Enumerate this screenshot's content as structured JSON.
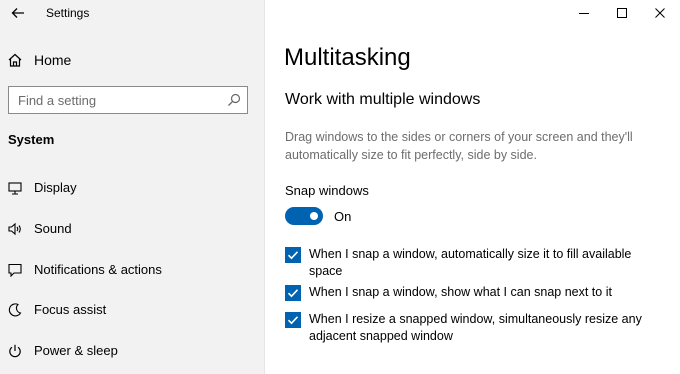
{
  "window": {
    "title": "Settings"
  },
  "sidebar": {
    "home_label": "Home",
    "search_placeholder": "Find a setting",
    "section_label": "System",
    "items": [
      {
        "label": "Display",
        "icon": "display-icon"
      },
      {
        "label": "Sound",
        "icon": "sound-icon"
      },
      {
        "label": "Notifications & actions",
        "icon": "notifications-icon"
      },
      {
        "label": "Focus assist",
        "icon": "focus-assist-icon"
      },
      {
        "label": "Power & sleep",
        "icon": "power-icon"
      }
    ]
  },
  "main": {
    "title": "Multitasking",
    "section_heading": "Work with multiple windows",
    "description": "Drag windows to the sides or corners of your screen and they'll automatically size to fit perfectly, side by side.",
    "snap": {
      "label": "Snap windows",
      "state_label": "On",
      "enabled": true
    },
    "options": [
      {
        "label": "When I snap a window, automatically size it to fill available space",
        "checked": true
      },
      {
        "label": "When I snap a window, show what I can snap next to it",
        "checked": true
      },
      {
        "label": "When I resize a snapped window, simultaneously resize any adjacent snapped window",
        "checked": true
      }
    ]
  },
  "colors": {
    "accent": "#0063b1",
    "sidebar_bg": "#f2f2f2",
    "description_text": "#6d6d6d"
  }
}
